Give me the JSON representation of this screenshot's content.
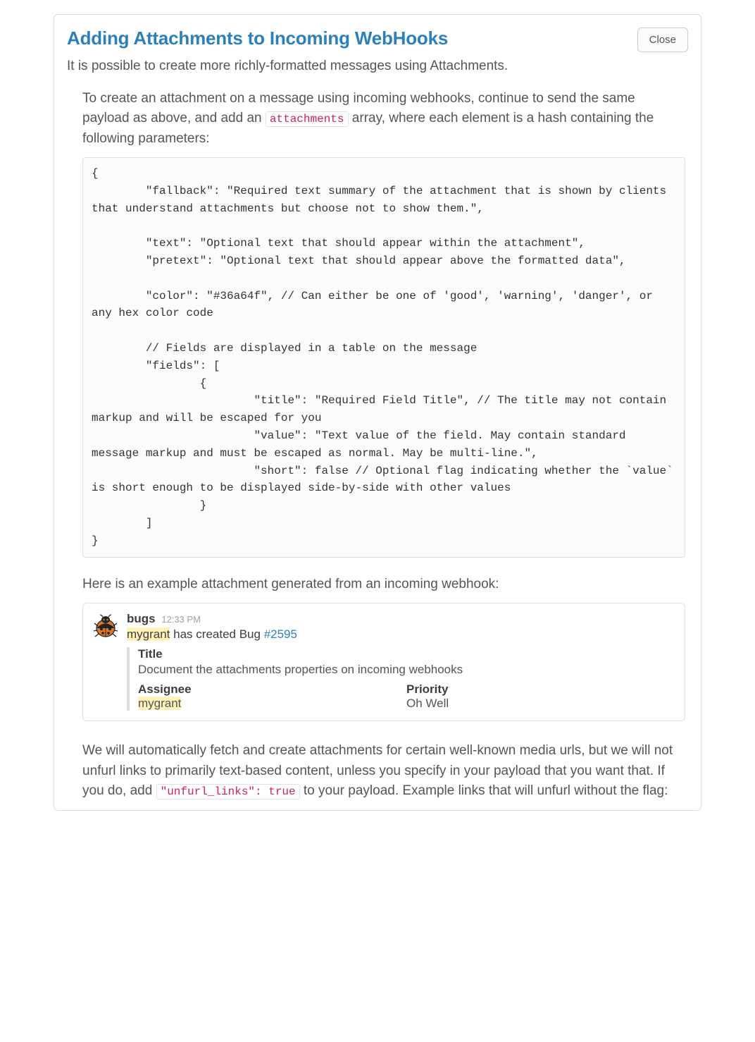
{
  "header": {
    "title": "Adding Attachments to Incoming WebHooks",
    "close_label": "Close"
  },
  "intro": "It is possible to create more richly-formatted messages using Attachments.",
  "p1_pre": "To create an attachment on a message using incoming webhooks, continue to send the same payload as above, and add an ",
  "p1_code": "attachments",
  "p1_post": " array, where each element is a hash containing the following parameters:",
  "code_block": "{\n        \"fallback\": \"Required text summary of the attachment that is shown by clients that understand attachments but choose not to show them.\",\n\n        \"text\": \"Optional text that should appear within the attachment\",\n        \"pretext\": \"Optional text that should appear above the formatted data\",\n\n        \"color\": \"#36a64f\", // Can either be one of 'good', 'warning', 'danger', or any hex color code\n\n        // Fields are displayed in a table on the message\n        \"fields\": [\n                {\n                        \"title\": \"Required Field Title\", // The title may not contain markup and will be escaped for you\n                        \"value\": \"Text value of the field. May contain standard message markup and must be escaped as normal. May be multi-line.\",\n                        \"short\": false // Optional flag indicating whether the `value` is short enough to be displayed side-by-side with other values\n                }\n        ]\n}",
  "p2": "Here is an example attachment generated from an incoming webhook:",
  "example": {
    "user": "bugs",
    "time": "12:33 PM",
    "line_pre_hl": "mygrant",
    "line_mid": " has created Bug ",
    "line_link": "#2595",
    "attach_title_label": "Title",
    "attach_title_value": "Document the attachments properties on incoming webhooks",
    "fields": [
      {
        "label": "Assignee",
        "value": "mygrant",
        "highlight": true
      },
      {
        "label": "Priority",
        "value": "Oh Well",
        "highlight": false
      }
    ]
  },
  "p3_pre": "We will automatically fetch and create attachments for certain well-known media urls, but we will not unfurl links to primarily text-based content, unless you specify in your payload that you want that. If you do, add ",
  "p3_code": "\"unfurl_links\": true",
  "p3_post": " to your payload. Example links that will unfurl without the flag:"
}
